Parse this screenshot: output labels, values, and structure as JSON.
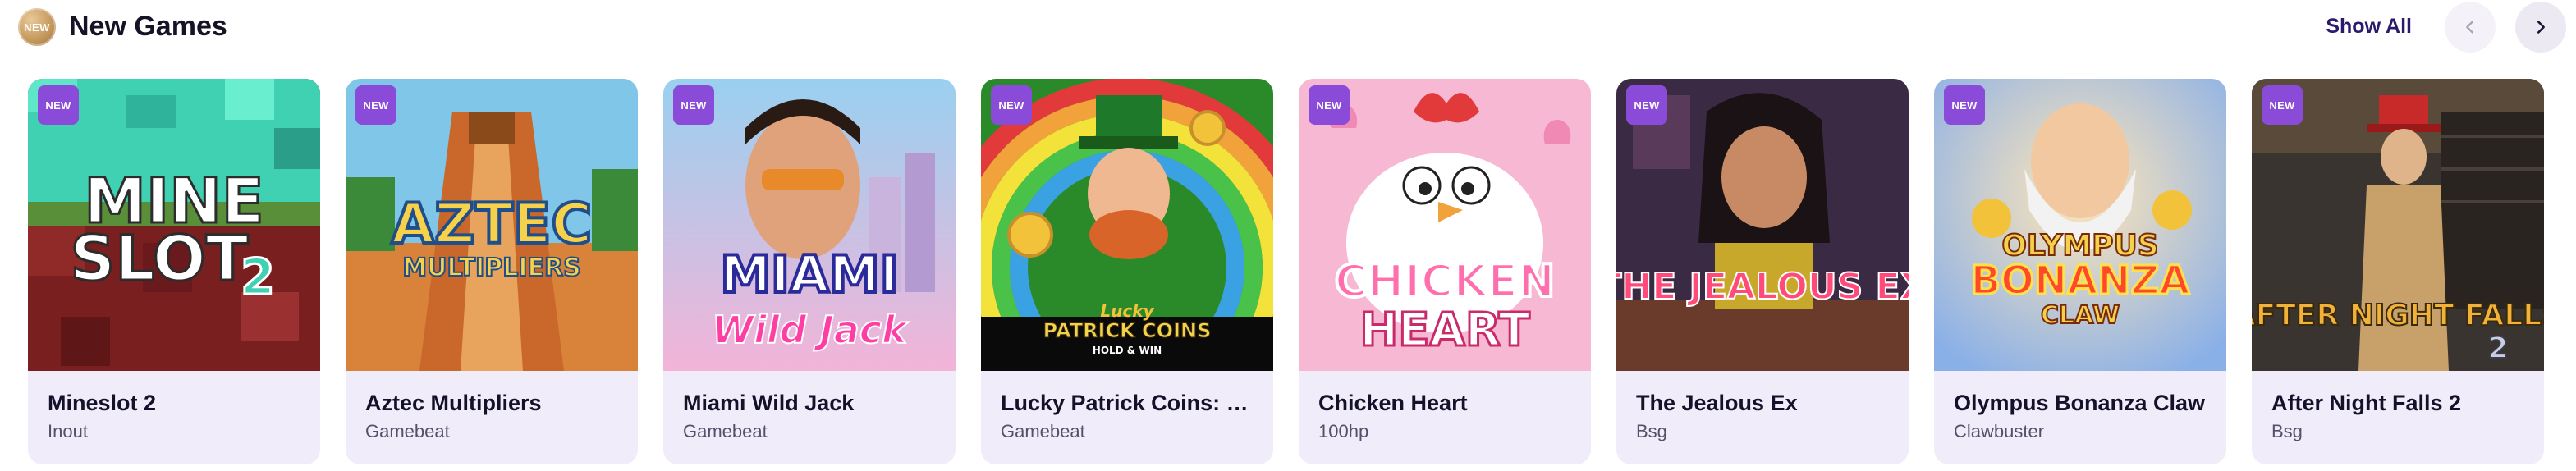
{
  "header": {
    "badge": "NEW",
    "title": "New Games",
    "show_all": "Show All"
  },
  "icons": {
    "prev": "chevron-left-icon",
    "next": "chevron-right-icon"
  },
  "badge_label": "NEW",
  "games": [
    {
      "name": "Mineslot 2",
      "provider": "Inout",
      "art_text": [
        "MINE",
        "SLOT",
        "2"
      ]
    },
    {
      "name": "Aztec Multipliers",
      "provider": "Gamebeat",
      "art_text": [
        "AZTEC",
        "MULTIPLIERS"
      ]
    },
    {
      "name": "Miami Wild Jack",
      "provider": "Gamebeat",
      "art_text": [
        "MIAMI",
        "Wild Jack"
      ]
    },
    {
      "name": "Lucky Patrick Coins: Hol…",
      "provider": "Gamebeat",
      "art_text": [
        "Lucky",
        "PATRICK COINS",
        "HOLD & WIN"
      ]
    },
    {
      "name": "Chicken Heart",
      "provider": "100hp",
      "art_text": [
        "CHICKEN",
        "HEART"
      ]
    },
    {
      "name": "The Jealous Ex",
      "provider": "Bsg",
      "art_text": [
        "THE JEALOUS EX"
      ]
    },
    {
      "name": "Olympus Bonanza Claw",
      "provider": "Clawbuster",
      "art_text": [
        "OLYMPUS",
        "BONANZA",
        "CLAW"
      ]
    },
    {
      "name": "After Night Falls 2",
      "provider": "Bsg",
      "art_text": [
        "AFTER NIGHT FALLS",
        "2"
      ]
    }
  ],
  "colors": {
    "accent": "#2b1a6b",
    "badge": "#8a4bd8",
    "card_bg": "#f1ecfa"
  }
}
